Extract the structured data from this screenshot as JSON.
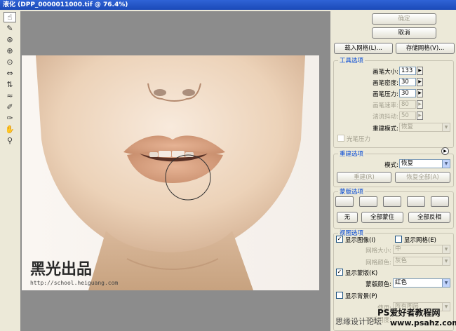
{
  "window": {
    "title": "液化 (DPP_0000011000.tif @ 76.4%)"
  },
  "toolbox": {
    "tools": [
      {
        "icon": "forward-warp-icon",
        "glyph": "☝"
      },
      {
        "icon": "reconstruct-icon",
        "glyph": "✎"
      },
      {
        "icon": "twirl-icon",
        "glyph": "⊛"
      },
      {
        "icon": "pucker-icon",
        "glyph": "⊕"
      },
      {
        "icon": "bloat-icon",
        "glyph": "⊙"
      },
      {
        "icon": "push-left-icon",
        "glyph": "⇔"
      },
      {
        "icon": "mirror-icon",
        "glyph": "⇅"
      },
      {
        "icon": "turbulence-icon",
        "glyph": "≈"
      },
      {
        "icon": "freeze-mask-icon",
        "glyph": "✐"
      },
      {
        "icon": "thaw-mask-icon",
        "glyph": "✑"
      },
      {
        "icon": "hand-icon",
        "glyph": "✋"
      },
      {
        "icon": "zoom-icon",
        "glyph": "⚲"
      }
    ]
  },
  "buttons": {
    "ok": "确定",
    "cancel": "取消",
    "load_mesh": "载入网格(L)...",
    "save_mesh": "存储网格(V)..."
  },
  "tool_options": {
    "title": "工具选项",
    "brush_size": {
      "label": "画笔大小:",
      "value": "133"
    },
    "brush_density": {
      "label": "画笔密度:",
      "value": "30"
    },
    "brush_pressure": {
      "label": "画笔压力:",
      "value": "30"
    },
    "brush_rate": {
      "label": "画笔速率:",
      "value": "80"
    },
    "turbulent_jitter": {
      "label": "湍流抖动:",
      "value": "50"
    },
    "reconstruct_mode": {
      "label": "重建模式:",
      "value": "恢复"
    },
    "stylus_pressure": {
      "label": "光笔压力"
    }
  },
  "reconstruct_options": {
    "title": "重建选项",
    "mode": {
      "label": "模式:",
      "value": "恢复"
    },
    "reconstruct_button": "重建(R)",
    "restore_all_button": "恢复全部(A)"
  },
  "mask_options": {
    "title": "蒙版选项",
    "none_button": "无",
    "mask_all_button": "全部蒙住",
    "invert_all_button": "全部反相"
  },
  "view_options": {
    "title": "视图选项",
    "show_image": "显示图像(I)",
    "show_mesh": "显示网格(E)",
    "mesh_size": {
      "label": "网格大小:",
      "value": "中"
    },
    "mesh_color": {
      "label": "网格颜色:",
      "value": "灰色"
    },
    "show_mask": "显示蒙版(K)",
    "mask_color": {
      "label": "蒙版颜色:",
      "value": "红色"
    },
    "show_backdrop": "显示背景(P)",
    "use": {
      "label": "使用:",
      "value": "所有图层"
    },
    "opacity": {
      "label": "不透明度:"
    }
  },
  "watermarks": {
    "photo_brand": "黑光出品",
    "photo_url": "http://school.heiguang.com",
    "site_name": "PS爱好者教程网",
    "site_url": "www.psahz.com",
    "forum": "思缘设计论坛"
  }
}
